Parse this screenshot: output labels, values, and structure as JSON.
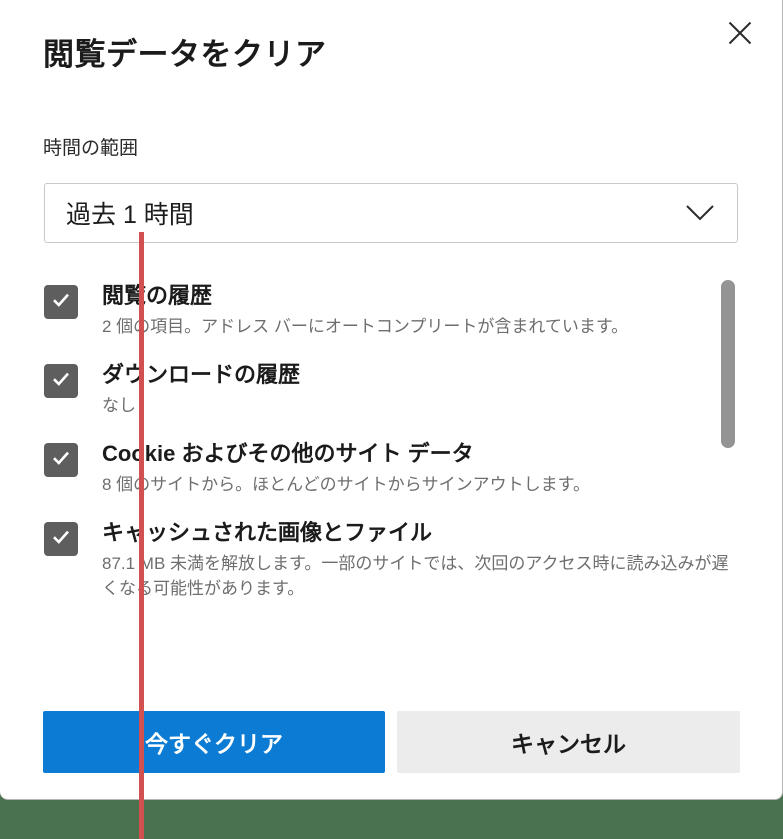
{
  "dialog": {
    "title": "閲覧データをクリア",
    "close_label": "×",
    "close_icon": "close-icon"
  },
  "time_range": {
    "label": "時間の範囲",
    "selected": "過去 1 時間",
    "chevron_icon": "chevron-down-icon"
  },
  "options": [
    {
      "title": "閲覧の履歴",
      "description": "2 個の項目。アドレス バーにオートコンプリートが含まれています。",
      "checked": true,
      "check_icon": "checkmark-icon"
    },
    {
      "title": "ダウンロードの履歴",
      "description": "なし",
      "checked": true,
      "check_icon": "checkmark-icon"
    },
    {
      "title": "Cookie およびその他のサイト データ",
      "description": "8 個のサイトから。ほとんどのサイトからサインアウトします。",
      "checked": true,
      "check_icon": "checkmark-icon"
    },
    {
      "title": "キャッシュされた画像とファイル",
      "description": "87.1 MB 未満を解放します。一部のサイトでは、次回のアクセス時に読み込みが遅くなる可能性があります。",
      "checked": true,
      "check_icon": "checkmark-icon"
    }
  ],
  "footer": {
    "clear_now_label": "今すぐクリア",
    "cancel_label": "キャンセル"
  },
  "scrollbar": {
    "name": "options-scrollbar"
  },
  "colors": {
    "accent_blue": "#0b7bd4",
    "checkbox_gray": "#5e5e5e",
    "secondary_button": "#ececec",
    "page_background_green": "#4a7250",
    "annotation_red": "#d0514f"
  }
}
